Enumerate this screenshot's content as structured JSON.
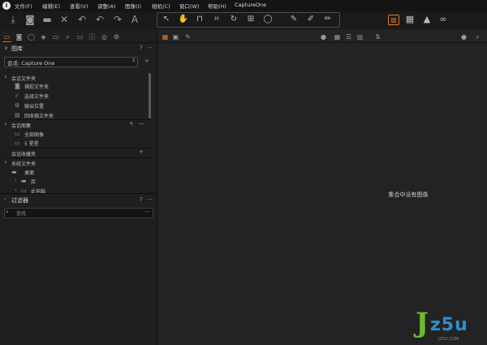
{
  "menubar": {
    "items": [
      "文件(F)",
      "编辑(E)",
      "查看(V)",
      "调整(A)",
      "图像(I)",
      "相机(C)",
      "窗口(W)",
      "帮助(H)"
    ],
    "title": "CaptureOne"
  },
  "toolbar": {
    "left_icons": [
      "import-icon",
      "camera-icon",
      "folder-icon",
      "delete-icon",
      "undo-all-icon",
      "undo-icon",
      "redo-icon",
      "text-icon"
    ],
    "cursor_tools": [
      "select-icon",
      "pan-icon",
      "loupe-icon",
      "crop-icon",
      "rotate-icon",
      "keystone-icon",
      "spot-icon",
      "picker-icon",
      "brush-icon",
      "eraser-icon"
    ],
    "right_icons": [
      "compare-icon",
      "grid-icon",
      "exposure-warning-icon",
      "proof-glasses-icon"
    ],
    "accent_color": "#e07b22"
  },
  "library": {
    "title": "图库",
    "help": "?",
    "more": "···",
    "session_label": "会话: Capture One",
    "session_folders_title": "会话文件夹",
    "session_folders": [
      "捕捉文件夹",
      "选择文件夹",
      "输出位置",
      "回收箱文件夹"
    ],
    "session_albums_title": "会话图集",
    "session_albums": [
      "全部图像",
      "5 星星"
    ],
    "session_favorites_title": "会话收藏夹",
    "system_folders_title": "系统文件夹",
    "system_folders": [
      "桌面",
      "库",
      "此电脑"
    ]
  },
  "filters": {
    "title": "过滤器",
    "help": "?",
    "more": "···",
    "search_placeholder": "查找"
  },
  "viewer": {
    "empty_message": "集合中没有图像"
  },
  "watermark": {
    "j": "J",
    "text": "z5u",
    "small": "JZ5U.COM"
  }
}
